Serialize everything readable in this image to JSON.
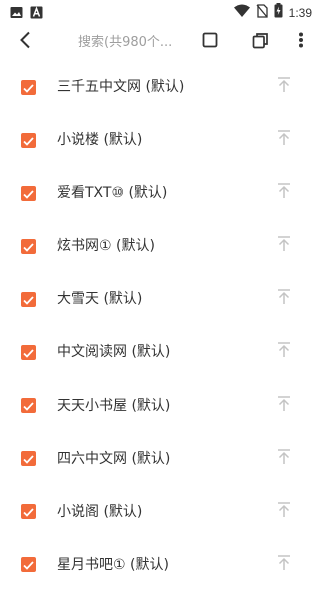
{
  "status_bar": {
    "time": "1:39",
    "left_icons": [
      "image-icon",
      "font-icon"
    ],
    "right_icons": [
      "wifi-icon",
      "no-sim-icon",
      "battery-charging-icon"
    ]
  },
  "toolbar": {
    "back_icon": "back-arrow-icon",
    "search_placeholder": "搜索(共980个...",
    "select_icon": "square-icon",
    "copy_icon": "copy-icon",
    "more_icon": "more-vertical-icon"
  },
  "colors": {
    "accent": "#f26b3a",
    "text": "#333333",
    "placeholder": "#9e9e9e",
    "icon_muted": "#c4c4c4"
  },
  "sources": [
    {
      "label": "三千五中文网 (默认)",
      "checked": true
    },
    {
      "label": "小说楼 (默认)",
      "checked": true
    },
    {
      "label": "爱看TXT⑩ (默认)",
      "checked": true
    },
    {
      "label": "炫书网① (默认)",
      "checked": true
    },
    {
      "label": "大雪天 (默认)",
      "checked": true
    },
    {
      "label": "中文阅读网 (默认)",
      "checked": true
    },
    {
      "label": "天天小书屋 (默认)",
      "checked": true
    },
    {
      "label": "四六中文网 (默认)",
      "checked": true
    },
    {
      "label": "小说阁 (默认)",
      "checked": true
    },
    {
      "label": "星月书吧① (默认)",
      "checked": true
    }
  ],
  "row_action_icon": "move-to-top-icon"
}
